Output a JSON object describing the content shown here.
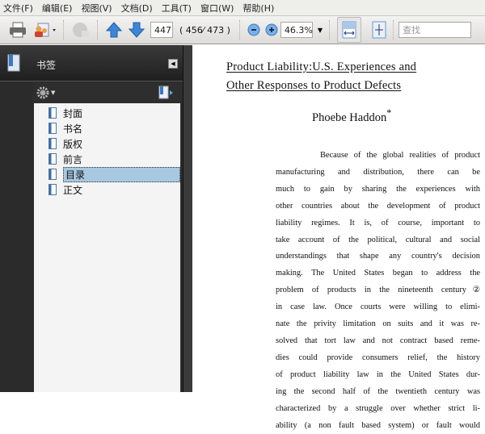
{
  "menu": [
    "文件(F)",
    "编辑(E)",
    "视图(V)",
    "文档(D)",
    "工具(T)",
    "窗口(W)",
    "帮助(H)"
  ],
  "toolbar": {
    "current_page": "447",
    "page_info": "( 456⁄ 473 )",
    "zoom": "46.3%",
    "search_placeholder": "查找"
  },
  "sidebar": {
    "title": "书签",
    "items": [
      {
        "label": "封面"
      },
      {
        "label": "书名"
      },
      {
        "label": "版权"
      },
      {
        "label": "前言"
      },
      {
        "label": "目录",
        "selected": true
      },
      {
        "label": "正文"
      }
    ]
  },
  "document": {
    "title_line1": "Product Liability:U.S. Experiences and",
    "title_line2": "Other Responses to Product Defects",
    "author": "Phoebe Haddon",
    "author_mark": "*",
    "lines": [
      "Because of the global realities of product",
      "manufacturing and distribution, there can be",
      "much to gain by sharing the experiences with",
      "other countries about the development of product",
      "liability regimes. It is, of course, important to",
      "take account of the political, cultural and social",
      "understandings that shape any country's decision",
      "making. The United States began to address the",
      "problem of products in the nineteenth century②",
      "in case law. Once courts were willing to elimi-",
      "nate the privity limitation on suits and it was re-",
      "solved that tort law and not contract based reme-",
      "dies could provide consumers relief, the history",
      "of product liability law in the United States dur-",
      "ing the second half of the twentieth century was",
      "characterized by a struggle over whether strict li-",
      "ability (a non fault based system) or fault would"
    ]
  }
}
